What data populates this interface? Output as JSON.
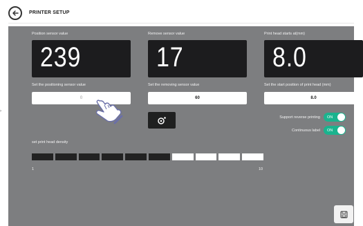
{
  "header": {
    "title": "PRINTER SETUP"
  },
  "sensors": {
    "position": {
      "label": "Position sensor value",
      "value": "239"
    },
    "remove": {
      "label": "Remove sensor value",
      "value": "17"
    },
    "print_head": {
      "label": "Print head starts at(mm)",
      "value": "8.0"
    }
  },
  "inputs": {
    "positioning": {
      "label": "Set the positioning sensor value",
      "value": "0"
    },
    "removing": {
      "label": "Set the removing sensor value",
      "value": "60"
    },
    "start_position": {
      "label": "Set the start position of print head (mm)",
      "value": "8.0"
    }
  },
  "toggles": {
    "reverse_printing": {
      "label": "Support reverse printing",
      "state": "ON"
    },
    "continuous_label": {
      "label": "Continuous label",
      "state": "ON"
    }
  },
  "density": {
    "label": "set print head density",
    "min_label": "1",
    "max_label": "10",
    "level": 6,
    "max": 10
  },
  "colors": {
    "panel": "#7d7e80",
    "value_box": "#1c1c1e",
    "toggle_on": "#1ab38e"
  }
}
